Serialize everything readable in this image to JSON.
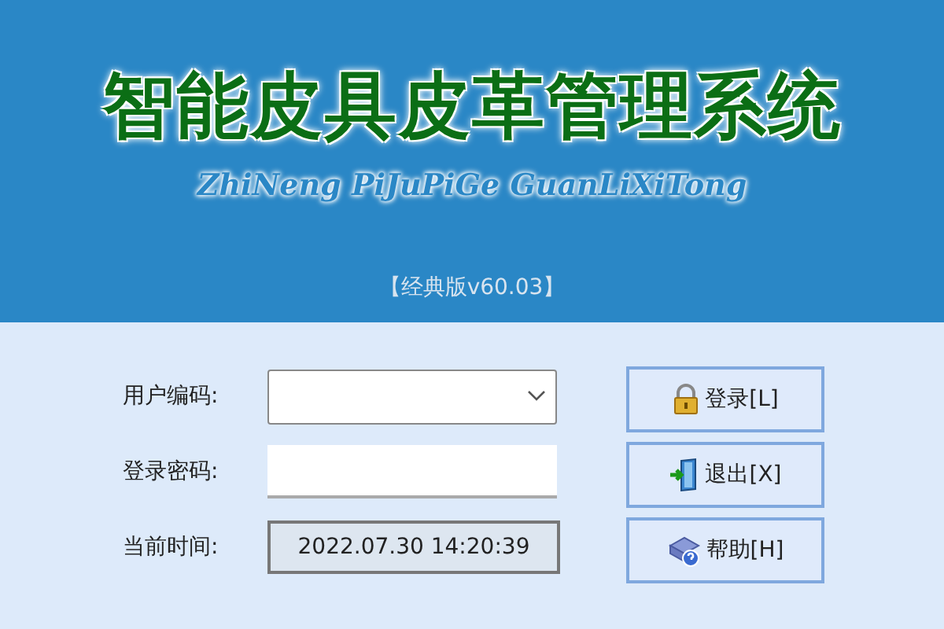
{
  "header": {
    "title": "智能皮具皮革管理系统",
    "subtitle": "ZhiNeng PiJuPiGe GuanLiXiTong",
    "edition": "【经典版v60.03】"
  },
  "fields": [
    {
      "kind": "combo",
      "label": "用户编码:"
    },
    {
      "kind": "password",
      "label": "登录密码:"
    },
    {
      "kind": "display",
      "label": "当前时间:",
      "value": "2022.07.30 14:20:39"
    }
  ],
  "buttons": [
    {
      "kind": "login",
      "label": "登录[L]"
    },
    {
      "kind": "exit",
      "label": "退出[X]"
    },
    {
      "kind": "help",
      "label": "帮助[H]"
    }
  ]
}
